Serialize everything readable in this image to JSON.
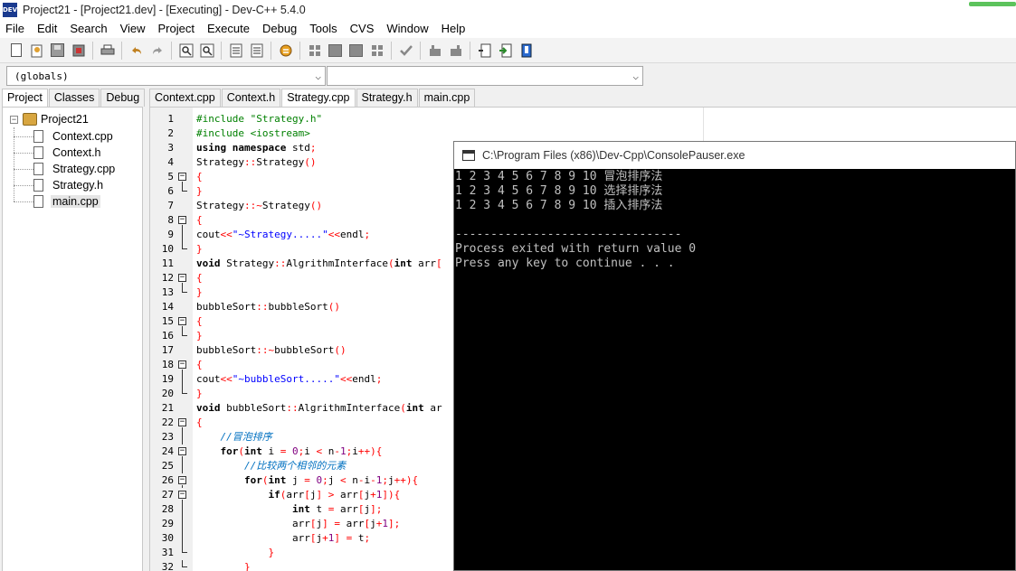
{
  "window": {
    "title": "Project21 - [Project21.dev] - [Executing] - Dev-C++ 5.4.0",
    "icon": "DEV"
  },
  "menu": [
    "File",
    "Edit",
    "Search",
    "View",
    "Project",
    "Execute",
    "Debug",
    "Tools",
    "CVS",
    "Window",
    "Help"
  ],
  "toolbar": {
    "icons": [
      "new-file-icon",
      "open-project-icon",
      "save-icon",
      "save-all-icon",
      "print-icon",
      "undo-icon",
      "redo-icon",
      "find-icon",
      "replace-icon",
      "indent-icon",
      "unindent-icon",
      "compile-icon",
      "grid-icon",
      "toggle-icon",
      "check-icon",
      "run-icon",
      "build-icon",
      "new-class-icon",
      "goto-icon",
      "bookmark-icon"
    ]
  },
  "scope_combo": {
    "value": "(globals)",
    "arrow": "⌵"
  },
  "member_combo": {
    "value": "",
    "arrow": "⌵"
  },
  "left_tabs": [
    "Project",
    "Classes",
    "Debug"
  ],
  "project_tree": {
    "root": "Project21",
    "collapse": "−",
    "files": [
      "Context.cpp",
      "Context.h",
      "Strategy.cpp",
      "Strategy.h",
      "main.cpp"
    ]
  },
  "editor_tabs": [
    "Context.cpp",
    "Context.h",
    "Strategy.cpp",
    "Strategy.h",
    "main.cpp"
  ],
  "code_lines": [
    {
      "n": "1",
      "fold": "",
      "segs": [
        {
          "t": "#include \"Strategy.h\"",
          "c": "c-pp"
        }
      ]
    },
    {
      "n": "2",
      "fold": "",
      "segs": [
        {
          "t": "#include <iostream>",
          "c": "c-pp"
        }
      ]
    },
    {
      "n": "3",
      "fold": "",
      "segs": [
        {
          "t": "using namespace",
          "c": "c-kw"
        },
        {
          "t": " std",
          "c": ""
        },
        {
          "t": ";",
          "c": "c-op"
        }
      ]
    },
    {
      "n": "4",
      "fold": "",
      "segs": [
        {
          "t": "Strategy",
          "c": ""
        },
        {
          "t": "::",
          "c": "c-op"
        },
        {
          "t": "Strategy",
          "c": ""
        },
        {
          "t": "()",
          "c": "c-op"
        }
      ]
    },
    {
      "n": "5",
      "fold": "open",
      "segs": [
        {
          "t": "{",
          "c": "c-op"
        }
      ]
    },
    {
      "n": "6",
      "fold": "end",
      "segs": [
        {
          "t": "}",
          "c": "c-op"
        }
      ]
    },
    {
      "n": "7",
      "fold": "",
      "segs": [
        {
          "t": "Strategy",
          "c": ""
        },
        {
          "t": "::~",
          "c": "c-op"
        },
        {
          "t": "Strategy",
          "c": ""
        },
        {
          "t": "()",
          "c": "c-op"
        }
      ]
    },
    {
      "n": "8",
      "fold": "open",
      "segs": [
        {
          "t": "{",
          "c": "c-op"
        }
      ]
    },
    {
      "n": "9",
      "fold": "mid",
      "segs": [
        {
          "t": "cout",
          "c": ""
        },
        {
          "t": "<<",
          "c": "c-op"
        },
        {
          "t": "\"~Strategy.....\"",
          "c": "c-str"
        },
        {
          "t": "<<",
          "c": "c-op"
        },
        {
          "t": "endl",
          "c": ""
        },
        {
          "t": ";",
          "c": "c-op"
        }
      ]
    },
    {
      "n": "10",
      "fold": "end",
      "segs": [
        {
          "t": "}",
          "c": "c-op"
        }
      ]
    },
    {
      "n": "11",
      "fold": "",
      "segs": [
        {
          "t": "void",
          "c": "c-kw"
        },
        {
          "t": " Strategy",
          "c": ""
        },
        {
          "t": "::",
          "c": "c-op"
        },
        {
          "t": "AlgrithmInterface",
          "c": ""
        },
        {
          "t": "(",
          "c": "c-op"
        },
        {
          "t": "int",
          "c": "c-kw"
        },
        {
          "t": " arr",
          "c": ""
        },
        {
          "t": "[",
          "c": "c-op"
        }
      ]
    },
    {
      "n": "12",
      "fold": "open",
      "segs": [
        {
          "t": "{",
          "c": "c-op"
        }
      ]
    },
    {
      "n": "13",
      "fold": "end",
      "segs": [
        {
          "t": "}",
          "c": "c-op"
        }
      ]
    },
    {
      "n": "14",
      "fold": "",
      "segs": [
        {
          "t": "bubbleSort",
          "c": ""
        },
        {
          "t": "::",
          "c": "c-op"
        },
        {
          "t": "bubbleSort",
          "c": ""
        },
        {
          "t": "()",
          "c": "c-op"
        }
      ]
    },
    {
      "n": "15",
      "fold": "open",
      "segs": [
        {
          "t": "{",
          "c": "c-op"
        }
      ]
    },
    {
      "n": "16",
      "fold": "end",
      "segs": [
        {
          "t": "}",
          "c": "c-op"
        }
      ]
    },
    {
      "n": "17",
      "fold": "",
      "segs": [
        {
          "t": "bubbleSort",
          "c": ""
        },
        {
          "t": "::~",
          "c": "c-op"
        },
        {
          "t": "bubbleSort",
          "c": ""
        },
        {
          "t": "()",
          "c": "c-op"
        }
      ]
    },
    {
      "n": "18",
      "fold": "open",
      "segs": [
        {
          "t": "{",
          "c": "c-op"
        }
      ]
    },
    {
      "n": "19",
      "fold": "mid",
      "segs": [
        {
          "t": "cout",
          "c": ""
        },
        {
          "t": "<<",
          "c": "c-op"
        },
        {
          "t": "\"~bubbleSort.....\"",
          "c": "c-str"
        },
        {
          "t": "<<",
          "c": "c-op"
        },
        {
          "t": "endl",
          "c": ""
        },
        {
          "t": ";",
          "c": "c-op"
        }
      ]
    },
    {
      "n": "20",
      "fold": "end",
      "segs": [
        {
          "t": "}",
          "c": "c-op"
        }
      ]
    },
    {
      "n": "21",
      "fold": "",
      "segs": [
        {
          "t": "void",
          "c": "c-kw"
        },
        {
          "t": " bubbleSort",
          "c": ""
        },
        {
          "t": "::",
          "c": "c-op"
        },
        {
          "t": "AlgrithmInterface",
          "c": ""
        },
        {
          "t": "(",
          "c": "c-op"
        },
        {
          "t": "int",
          "c": "c-kw"
        },
        {
          "t": " ar",
          "c": ""
        }
      ]
    },
    {
      "n": "22",
      "fold": "open",
      "segs": [
        {
          "t": "{",
          "c": "c-op"
        }
      ]
    },
    {
      "n": "23",
      "fold": "mid",
      "segs": [
        {
          "t": "    ",
          "c": ""
        },
        {
          "t": "//冒泡排序",
          "c": "c-cm"
        }
      ]
    },
    {
      "n": "24",
      "fold": "open2",
      "segs": [
        {
          "t": "    ",
          "c": ""
        },
        {
          "t": "for",
          "c": "c-kw"
        },
        {
          "t": "(",
          "c": "c-op"
        },
        {
          "t": "int",
          "c": "c-kw"
        },
        {
          "t": " i ",
          "c": ""
        },
        {
          "t": "=",
          "c": "c-op"
        },
        {
          "t": " 0",
          "c": "c-num"
        },
        {
          "t": ";",
          "c": "c-op"
        },
        {
          "t": "i ",
          "c": ""
        },
        {
          "t": "<",
          "c": "c-op"
        },
        {
          "t": " n",
          "c": ""
        },
        {
          "t": "-",
          "c": "c-op"
        },
        {
          "t": "1",
          "c": "c-num"
        },
        {
          "t": ";",
          "c": "c-op"
        },
        {
          "t": "i",
          "c": ""
        },
        {
          "t": "++){",
          "c": "c-op"
        }
      ]
    },
    {
      "n": "25",
      "fold": "mid",
      "segs": [
        {
          "t": "        ",
          "c": ""
        },
        {
          "t": "//比较两个相邻的元素",
          "c": "c-cm"
        }
      ]
    },
    {
      "n": "26",
      "fold": "open2",
      "segs": [
        {
          "t": "        ",
          "c": ""
        },
        {
          "t": "for",
          "c": "c-kw"
        },
        {
          "t": "(",
          "c": "c-op"
        },
        {
          "t": "int",
          "c": "c-kw"
        },
        {
          "t": " j ",
          "c": ""
        },
        {
          "t": "=",
          "c": "c-op"
        },
        {
          "t": " 0",
          "c": "c-num"
        },
        {
          "t": ";",
          "c": "c-op"
        },
        {
          "t": "j ",
          "c": ""
        },
        {
          "t": "<",
          "c": "c-op"
        },
        {
          "t": " n",
          "c": ""
        },
        {
          "t": "-",
          "c": "c-op"
        },
        {
          "t": "i",
          "c": ""
        },
        {
          "t": "-",
          "c": "c-op"
        },
        {
          "t": "1",
          "c": "c-num"
        },
        {
          "t": ";",
          "c": "c-op"
        },
        {
          "t": "j",
          "c": ""
        },
        {
          "t": "++){",
          "c": "c-op"
        }
      ]
    },
    {
      "n": "27",
      "fold": "open2",
      "segs": [
        {
          "t": "            ",
          "c": ""
        },
        {
          "t": "if",
          "c": "c-kw"
        },
        {
          "t": "(",
          "c": "c-op"
        },
        {
          "t": "arr",
          "c": ""
        },
        {
          "t": "[",
          "c": "c-op"
        },
        {
          "t": "j",
          "c": ""
        },
        {
          "t": "] >",
          "c": "c-op"
        },
        {
          "t": " arr",
          "c": ""
        },
        {
          "t": "[",
          "c": "c-op"
        },
        {
          "t": "j",
          "c": ""
        },
        {
          "t": "+",
          "c": "c-op"
        },
        {
          "t": "1",
          "c": "c-num"
        },
        {
          "t": "]){",
          "c": "c-op"
        }
      ]
    },
    {
      "n": "28",
      "fold": "mid",
      "segs": [
        {
          "t": "                ",
          "c": ""
        },
        {
          "t": "int",
          "c": "c-kw"
        },
        {
          "t": " t ",
          "c": ""
        },
        {
          "t": "=",
          "c": "c-op"
        },
        {
          "t": " arr",
          "c": ""
        },
        {
          "t": "[",
          "c": "c-op"
        },
        {
          "t": "j",
          "c": ""
        },
        {
          "t": "];",
          "c": "c-op"
        }
      ]
    },
    {
      "n": "29",
      "fold": "mid",
      "segs": [
        {
          "t": "                ",
          "c": ""
        },
        {
          "t": "arr",
          "c": ""
        },
        {
          "t": "[",
          "c": "c-op"
        },
        {
          "t": "j",
          "c": ""
        },
        {
          "t": "] =",
          "c": "c-op"
        },
        {
          "t": " arr",
          "c": ""
        },
        {
          "t": "[",
          "c": "c-op"
        },
        {
          "t": "j",
          "c": ""
        },
        {
          "t": "+",
          "c": "c-op"
        },
        {
          "t": "1",
          "c": "c-num"
        },
        {
          "t": "];",
          "c": "c-op"
        }
      ]
    },
    {
      "n": "30",
      "fold": "mid",
      "segs": [
        {
          "t": "                ",
          "c": ""
        },
        {
          "t": "arr",
          "c": ""
        },
        {
          "t": "[",
          "c": "c-op"
        },
        {
          "t": "j",
          "c": ""
        },
        {
          "t": "+",
          "c": "c-op"
        },
        {
          "t": "1",
          "c": "c-num"
        },
        {
          "t": "] =",
          "c": "c-op"
        },
        {
          "t": " t",
          "c": ""
        },
        {
          "t": ";",
          "c": "c-op"
        }
      ]
    },
    {
      "n": "31",
      "fold": "end",
      "segs": [
        {
          "t": "            ",
          "c": ""
        },
        {
          "t": "}",
          "c": "c-op"
        }
      ]
    },
    {
      "n": "32",
      "fold": "end",
      "segs": [
        {
          "t": "        ",
          "c": ""
        },
        {
          "t": "}",
          "c": "c-op"
        }
      ]
    }
  ],
  "console": {
    "title": "C:\\Program Files (x86)\\Dev-Cpp\\ConsolePauser.exe",
    "lines": [
      "1 2 3 4 5 6 7 8 9 10 冒泡排序法",
      "1 2 3 4 5 6 7 8 9 10 选择排序法",
      "1 2 3 4 5 6 7 8 9 10 插入排序法",
      "",
      "--------------------------------",
      "Process exited with return value 0",
      "Press any key to continue . . ."
    ]
  }
}
